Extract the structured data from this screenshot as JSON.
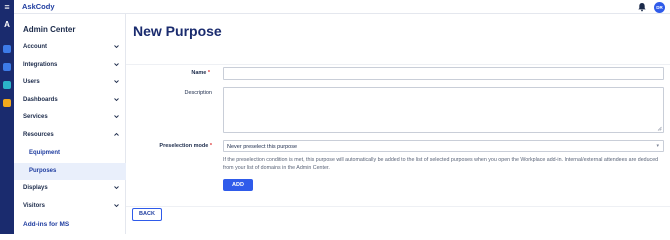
{
  "app": {
    "brand": "AskCody",
    "avatar_initials": "DR"
  },
  "sidebar": {
    "title": "Admin Center",
    "items": [
      {
        "label": "Account",
        "expanded": false
      },
      {
        "label": "Integrations",
        "expanded": false
      },
      {
        "label": "Users",
        "expanded": false
      },
      {
        "label": "Dashboards",
        "expanded": false
      },
      {
        "label": "Services",
        "expanded": false
      },
      {
        "label": "Resources",
        "expanded": true
      },
      {
        "label": "Displays",
        "expanded": false
      },
      {
        "label": "Visitors",
        "expanded": false
      }
    ],
    "resources_sub": [
      {
        "label": "Equipment",
        "active": false
      },
      {
        "label": "Purposes",
        "active": true
      }
    ],
    "addins_label": "Add-ins for MS"
  },
  "rail": {
    "icons": [
      {
        "name": "meetings-icon",
        "color": "#3d7be8"
      },
      {
        "name": "visitors-icon",
        "color": "#3d7be8"
      },
      {
        "name": "services-icon",
        "color": "#2bb5c9"
      },
      {
        "name": "dashboards-icon",
        "color": "#f2a91d"
      }
    ]
  },
  "page": {
    "title": "New Purpose"
  },
  "form": {
    "name_label": "Name",
    "name_value": "",
    "description_label": "Description",
    "description_value": "",
    "preselection_label": "Preselection mode",
    "preselection_value": "Never preselect this purpose",
    "help_text": "If the preselection condition is met, this purpose will automatically be added to the list of selected purposes when you open the Workplace add-in. Internal/external attendees are deduced from your list of domains in the Admin Center.",
    "required_marker": "*",
    "add_label": "ADD"
  },
  "footer": {
    "back_label": "BACK"
  },
  "colors": {
    "accent": "#2f5bea",
    "navy": "#1a2b6e",
    "required": "#dd3333"
  }
}
